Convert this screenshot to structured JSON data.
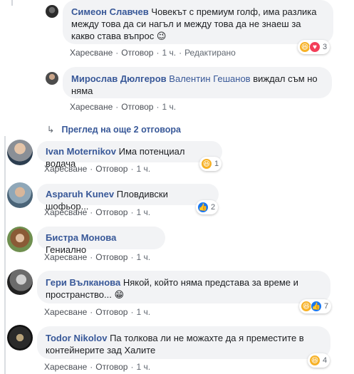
{
  "replies": [
    {
      "author": "Симеон Славчев",
      "text": "Човекът с премиум голф, има разлика между това да си нагъл и между това да не знаеш за какво става въпрос 😉",
      "like": "Харесване",
      "reply": "Отговор",
      "time": "1 ч.",
      "edited": "Редактирано",
      "reaction_count": "3",
      "reaction_icons": [
        "haha-icon",
        "love-icon"
      ]
    },
    {
      "author": "Мирослав Дюлгеров",
      "mention": "Валентин Гешанов",
      "text": "виждал съм но няма",
      "like": "Харесване",
      "reply": "Отговор",
      "time": "1 ч."
    }
  ],
  "more_replies": "Преглед на още 2 отговора",
  "comments": [
    {
      "author": "Ivan Moternikov",
      "text": "Има потенциал водача",
      "like": "Харесване",
      "reply": "Отговор",
      "time": "1 ч.",
      "reaction_count": "1",
      "reaction_icons": [
        "haha-icon"
      ]
    },
    {
      "author": "Asparuh Kunev",
      "text": "Пловдивски шофьор...",
      "like": "Харесване",
      "reply": "Отговор",
      "time": "1 ч.",
      "reaction_count": "2",
      "reaction_icons": [
        "like-icon"
      ]
    },
    {
      "author": "Бистра Монова",
      "text": "Гениално",
      "like": "Харесване",
      "reply": "Отговор",
      "time": "1 ч."
    },
    {
      "author": "Гери Вълканова",
      "text": "Някой, който няма представа за време и пространство... 😁",
      "like": "Харесване",
      "reply": "Отговор",
      "time": "1 ч.",
      "reaction_count": "7",
      "reaction_icons": [
        "haha-icon",
        "like-icon"
      ]
    },
    {
      "author": "Todor Nikolov",
      "text": "Па толкова ли не можахте да я преместите в контейнерите зад Халите",
      "like": "Харесване",
      "reply": "Отговор",
      "time": "1 ч.",
      "reaction_count": "4",
      "reaction_icons": [
        "haha-icon"
      ]
    }
  ]
}
